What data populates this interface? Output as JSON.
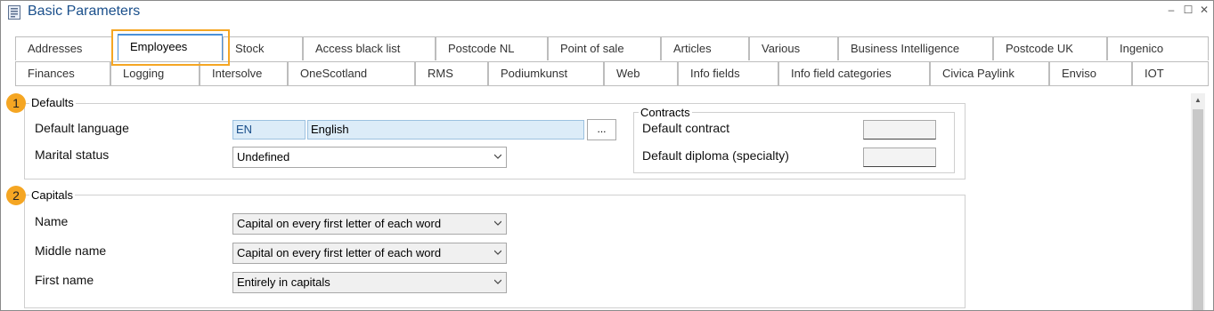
{
  "window": {
    "title": "Basic Parameters",
    "icon": "document-form-icon",
    "controls": {
      "minimize": "–",
      "maximize": "☐",
      "close": "✕"
    }
  },
  "tabs": {
    "row1": [
      "Addresses",
      "Employees",
      "Stock",
      "Access black list",
      "Postcode NL",
      "Point of sale",
      "Articles",
      "Various",
      "Business Intelligence",
      "Postcode UK",
      "Ingenico"
    ],
    "row2": [
      "Finances",
      "Logging",
      "Intersolve",
      "OneScotland",
      "RMS",
      "Podiumkunst",
      "Web",
      "Info fields",
      "Info field categories",
      "Civica Paylink",
      "Enviso",
      "IOT"
    ],
    "active": "Employees"
  },
  "defaults": {
    "badge": "1",
    "label": "Defaults",
    "default_language_label": "Default language",
    "language_code": "EN",
    "language_name": "English",
    "browse_button": "...",
    "marital_status_label": "Marital status",
    "marital_status_value": "Undefined"
  },
  "contracts": {
    "label": "Contracts",
    "default_contract_label": "Default contract",
    "default_contract_value": "",
    "default_diploma_label": "Default diploma (specialty)",
    "default_diploma_value": ""
  },
  "capitals": {
    "badge": "2",
    "label": "Capitals",
    "name_label": "Name",
    "name_value": "Capital on every first letter of each word",
    "middle_name_label": "Middle name",
    "middle_name_value": "Capital on every first letter of each word",
    "first_name_label": "First name",
    "first_name_value": "Entirely in capitals"
  },
  "colors": {
    "title": "#1a4f8b",
    "highlight": "#f5a623",
    "active_tab": "#4a90d9",
    "field_bg": "#dcecf8"
  }
}
